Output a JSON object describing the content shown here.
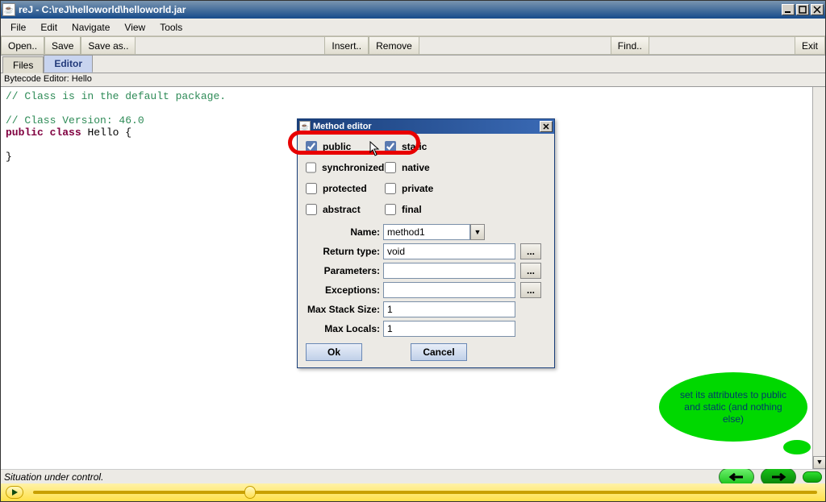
{
  "window": {
    "title": "reJ - C:\\reJ\\helloworld\\helloworld.jar"
  },
  "menubar": [
    "File",
    "Edit",
    "Navigate",
    "View",
    "Tools"
  ],
  "toolbar": {
    "open": "Open..",
    "save": "Save",
    "saveas": "Save as..",
    "insert": "Insert..",
    "remove": "Remove",
    "find": "Find..",
    "exit": "Exit"
  },
  "tabs": {
    "files": "Files",
    "editor": "Editor"
  },
  "subheader": "Bytecode Editor: Hello",
  "code": {
    "l1": "// Class is in the default package.",
    "l2": "// Class Version: 46.0",
    "l3a": "public",
    "l3b": "class",
    "l3c": " Hello {",
    "l4": "}"
  },
  "dialog": {
    "title": "Method editor",
    "checks": {
      "public": "public",
      "static": "static",
      "synchronized": "synchronized",
      "native": "native",
      "protected": "protected",
      "private": "private",
      "abstract": "abstract",
      "final": "final"
    },
    "labels": {
      "name": "Name:",
      "returntype": "Return type:",
      "parameters": "Parameters:",
      "exceptions": "Exceptions:",
      "maxstack": "Max Stack Size:",
      "maxlocals": "Max Locals:"
    },
    "values": {
      "name": "method1",
      "returntype": "void",
      "parameters": "",
      "exceptions": "",
      "maxstack": "1",
      "maxlocals": "1"
    },
    "ellipsis": "...",
    "ok": "Ok",
    "cancel": "Cancel"
  },
  "annotation": "set its attributes to public and static (and nothing else)",
  "status": "Situation under control."
}
